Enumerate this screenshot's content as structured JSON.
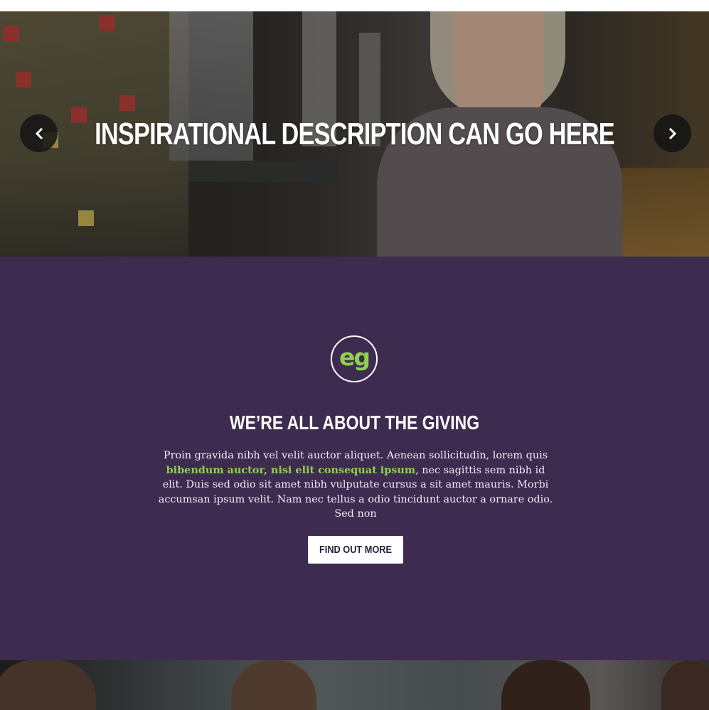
{
  "hero": {
    "title": "INSPIRATIONAL DESCRIPTION CAN GO HERE",
    "prev_icon": "chevron-left-icon",
    "next_icon": "chevron-right-icon"
  },
  "about": {
    "logo_text": "eg",
    "title": "WE’RE ALL ABOUT THE GIVING",
    "body_part1": "Proin gravida nibh vel velit auctor aliquet. Aenean sollicitudin, lorem quis ",
    "body_highlight": "bibendum auctor, nisi elit consequat ipsum",
    "body_part2": ", nec sagittis sem nibh id elit. Duis sed odio sit amet nibh vulputate cursus a sit amet mauris. Morbi accumsan ipsum velit. Nam nec tellus a odio tincidunt auctor a ornare odio. Sed non",
    "button_label": "FIND OUT MORE"
  },
  "colors": {
    "section_bg": "#3e2b50",
    "accent": "#8fd14f",
    "button_bg": "#ffffff"
  }
}
